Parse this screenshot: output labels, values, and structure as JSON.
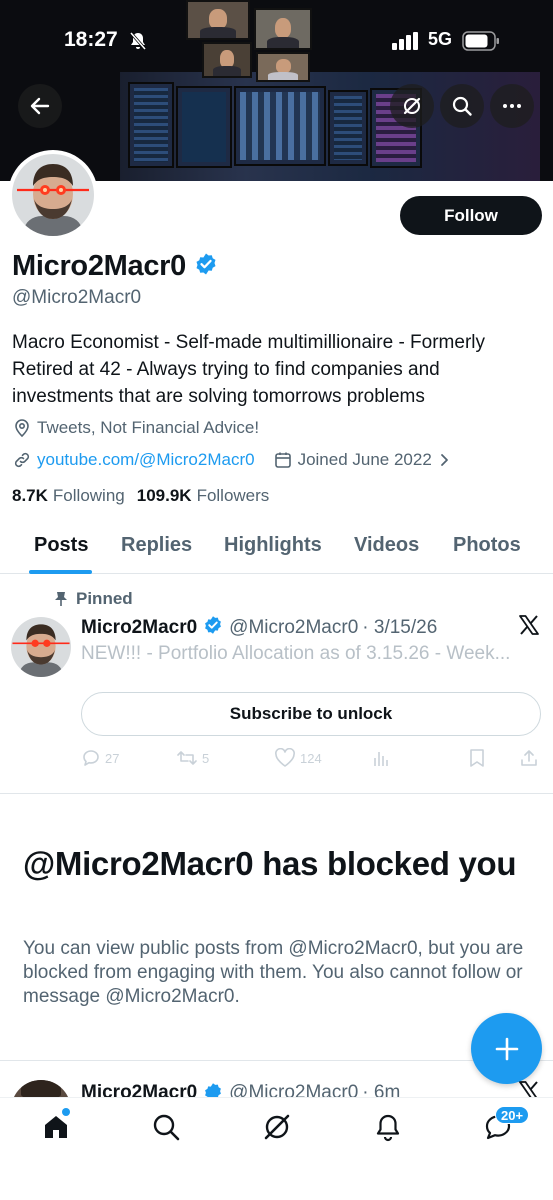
{
  "status_bar": {
    "time": "18:27",
    "network": "5G"
  },
  "profile": {
    "display_name": "Micro2Macr0",
    "handle": "@Micro2Macr0",
    "follow_label": "Follow",
    "bio": "Macro Economist - Self-made multimillionaire - Formerly Retired at 42 - Always trying to find companies and investments that are solving tomorrows problems",
    "location": "Tweets, Not Financial Advice!",
    "website": "youtube.com/@Micro2Macr0",
    "joined": "Joined June 2022",
    "following_count": "8.7K",
    "following_label": "Following",
    "followers_count": "109.9K",
    "followers_label": "Followers"
  },
  "tabs": [
    "Posts",
    "Replies",
    "Highlights",
    "Videos",
    "Photos"
  ],
  "active_tab": "Posts",
  "pinned_post": {
    "pinned_label": "Pinned",
    "author_name": "Micro2Macr0",
    "author_handle": "@Micro2Macr0",
    "date": "· 3/15/26",
    "text": "NEW!!! - Portfolio Allocation as of 3.15.26 - Week...",
    "subscribe_label": "Subscribe to unlock",
    "replies": "27",
    "reposts": "5",
    "likes": "124"
  },
  "blocked_notice": {
    "title": "@Micro2Macr0 has blocked you",
    "description": "You can view public posts from @Micro2Macr0, but you are blocked from engaging with them. You also cannot follow or message @Micro2Macr0."
  },
  "next_post": {
    "author_name": "Micro2Macr0",
    "author_handle": "@Micro2Macr0",
    "time": "· 6m"
  },
  "bottom_nav": {
    "messages_badge": "20+"
  },
  "colors": {
    "accent": "#1d9bf0",
    "text": "#0f1419",
    "muted": "#536471"
  }
}
